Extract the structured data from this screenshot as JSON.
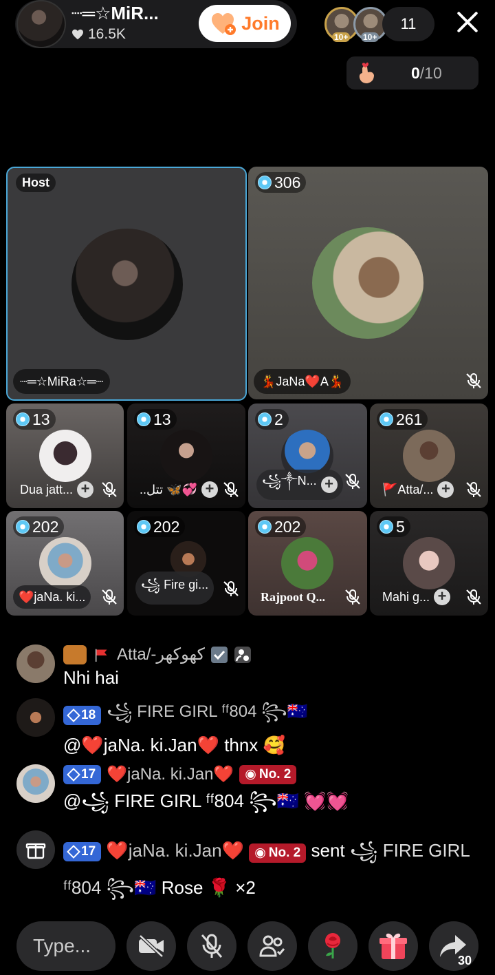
{
  "header": {
    "host_name": "┈═☆MiR...",
    "likes": "16.5K",
    "join_label": "Join",
    "viewer_badge": "10+",
    "viewer_count": "11",
    "counter_current": "0",
    "counter_max": "/10"
  },
  "seats": {
    "host": {
      "tag": "Host",
      "name": "┈═☆MiRa☆═┈"
    },
    "seat2": {
      "score": "306",
      "name": "💃JaNa❤️A💃"
    },
    "row1": [
      {
        "score": "13",
        "name": "Dua jatt..."
      },
      {
        "score": "13",
        "name": "..تتل 🦋💞"
      },
      {
        "score": "2",
        "name": "꧁༒N..."
      },
      {
        "score": "261",
        "name": "🚩Atta/..."
      }
    ],
    "row2": [
      {
        "score": "202",
        "name": "❤️jaNa. ki..."
      },
      {
        "score": "202",
        "name": "꧁ Fire gi..."
      },
      {
        "score": "202",
        "name": "Rajpoot Q..."
      },
      {
        "score": "5",
        "name": "Mahi g..."
      }
    ]
  },
  "chat": [
    {
      "user": "Atta/-کھوکھر",
      "message": "Nhi hai"
    },
    {
      "level": "18",
      "user": "꧁ FIRE GIRL ᶠᶠ804 ꧂🇦🇺",
      "message": "@❤️jaNa. ki.Jan❤️ thnx 🥰"
    },
    {
      "level": "17",
      "user": "❤️jaNa. ki.Jan❤️",
      "rank": "No. 2",
      "message": "@꧁ FIRE GIRL ᶠᶠ804 ꧂🇦🇺 💓💓"
    },
    {
      "level": "17",
      "user": "❤️jaNa. ki.Jan❤️",
      "rank": "No. 2",
      "sent": "sent",
      "target": "꧁ FIRE GIRL ᶠᶠ804 ꧂🇦🇺",
      "gift": "Rose 🌹 ×2"
    }
  ],
  "bottom": {
    "input_placeholder": "Type...",
    "share_count": "30"
  },
  "colors": {
    "accent_blue": "#4aa8d8",
    "join_orange": "#ff7a2a",
    "level_blue": "#3467d6",
    "rank_red": "#b51a2a"
  },
  "icons": [
    "heart-icon",
    "close-icon",
    "hand-heart-icon",
    "mic-muted-icon",
    "camera-off-icon",
    "users-icon",
    "rose-icon",
    "gift-icon",
    "share-icon"
  ]
}
